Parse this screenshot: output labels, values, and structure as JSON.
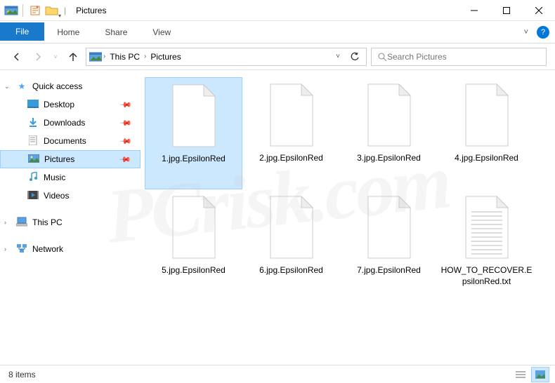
{
  "window": {
    "title": "Pictures",
    "separator": "|"
  },
  "ribbon": {
    "file_label": "File",
    "tabs": [
      "Home",
      "Share",
      "View"
    ]
  },
  "address": {
    "root": "This PC",
    "current": "Pictures",
    "chevron": "›"
  },
  "search": {
    "placeholder": "Search Pictures"
  },
  "sidebar": {
    "quick_access": "Quick access",
    "items": [
      {
        "label": "Desktop",
        "icon": "desktop",
        "pinned": true
      },
      {
        "label": "Downloads",
        "icon": "downloads",
        "pinned": true
      },
      {
        "label": "Documents",
        "icon": "documents",
        "pinned": true
      },
      {
        "label": "Pictures",
        "icon": "pictures",
        "pinned": true,
        "selected": true
      },
      {
        "label": "Music",
        "icon": "music",
        "pinned": false
      },
      {
        "label": "Videos",
        "icon": "videos",
        "pinned": false
      }
    ],
    "this_pc": "This PC",
    "network": "Network"
  },
  "files": [
    {
      "name": "1.jpg.EpsilonRed",
      "type": "blank",
      "selected": true
    },
    {
      "name": "2.jpg.EpsilonRed",
      "type": "blank"
    },
    {
      "name": "3.jpg.EpsilonRed",
      "type": "blank"
    },
    {
      "name": "4.jpg.EpsilonRed",
      "type": "blank"
    },
    {
      "name": "5.jpg.EpsilonRed",
      "type": "blank"
    },
    {
      "name": "6.jpg.EpsilonRed",
      "type": "blank"
    },
    {
      "name": "7.jpg.EpsilonRed",
      "type": "blank"
    },
    {
      "name": "HOW_TO_RECOVER.EpsilonRed.txt",
      "type": "text"
    }
  ],
  "status": {
    "count_label": "8 items"
  },
  "watermark": "PCrisk.com"
}
